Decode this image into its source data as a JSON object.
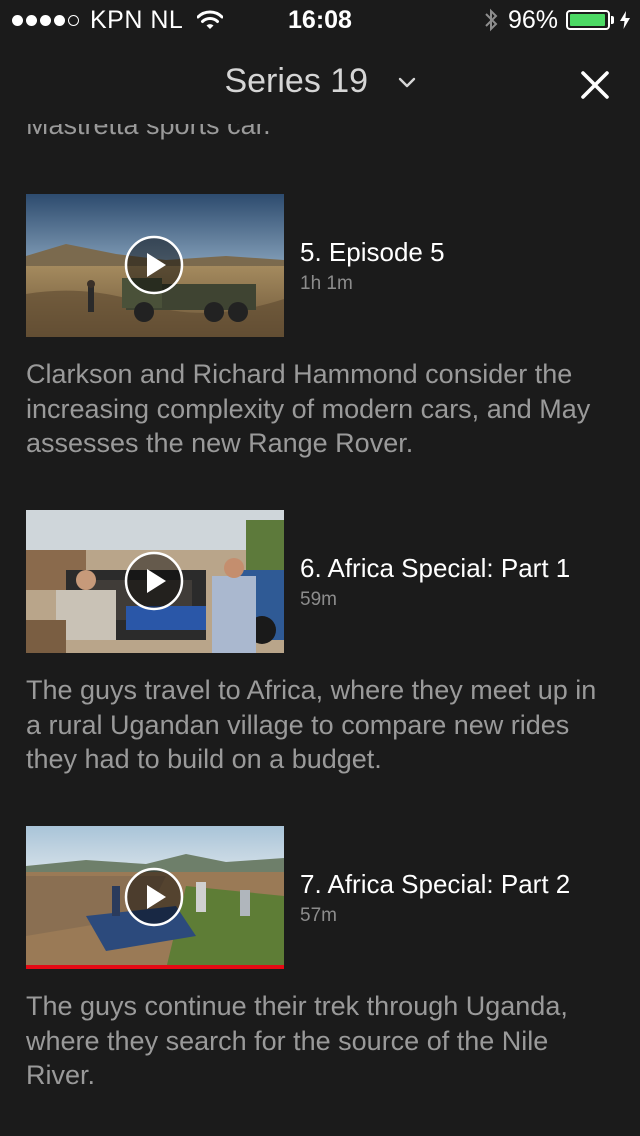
{
  "status_bar": {
    "carrier": "KPN NL",
    "time": "16:08",
    "battery_percent": "96%",
    "battery_level": 0.96,
    "signal_bars": 4,
    "signal_max": 5
  },
  "header": {
    "series_label": "Series 19",
    "dropdown_icon": "chevron-down-icon",
    "close_icon": "close-icon"
  },
  "previous_description_tail": "Mastretta sports car.",
  "episodes": [
    {
      "title": "5. Episode 5",
      "duration": "1h 1m",
      "description": "Clarkson and Richard Hammond consider the increasing complexity of modern cars, and May assesses the new Range Rover.",
      "watched_progress": 0
    },
    {
      "title": "6. Africa Special: Part 1",
      "duration": "59m",
      "description": "The guys travel to Africa, where they meet up in a rural Ugandan village to compare new rides they had to build on a budget.",
      "watched_progress": 0
    },
    {
      "title": "7. Africa Special: Part 2",
      "duration": "57m",
      "description": "The guys continue their trek through Uganda, where they search for the source of the Nile River.",
      "watched_progress": 1.0
    }
  ],
  "colors": {
    "background": "#1b1b1b",
    "progress": "#e50914",
    "battery": "#4cd964"
  }
}
